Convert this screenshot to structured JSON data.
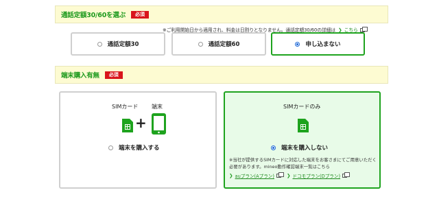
{
  "call_plan": {
    "title": "通話定額30/60を選ぶ",
    "badge": "必須",
    "note": "※ご利用開始日から適用され、料金は日割りとなりません。通話定額30/60の詳細は",
    "note_link": "こちら",
    "options": [
      {
        "label": "通話定額30",
        "selected": false
      },
      {
        "label": "通話定額60",
        "selected": false
      },
      {
        "label": "申し込まない",
        "selected": true
      }
    ]
  },
  "device": {
    "title": "端末購入有無",
    "badge": "必須",
    "left_card": {
      "sim_label": "SIMカード",
      "device_label": "端末",
      "plus": "+",
      "choice_label": "端末を購入する",
      "selected": false
    },
    "right_card": {
      "sim_label": "SIMカードのみ",
      "choice_label": "端末を購入しない",
      "selected": true,
      "note": "※当社が提供するSIMカードに対応した端末をお客さまにてご用意いただく必要があります。mineo動作確認端末一覧はこちら",
      "link_a": "auプラン(Aプラン)",
      "link_d": "ドコモプラン(Dプラン)"
    }
  },
  "colors": {
    "accent_green": "#1ea31e",
    "required_red": "#d9141c",
    "selected_bg": "#e8fbe8",
    "header_bg": "#fdfbd2"
  }
}
